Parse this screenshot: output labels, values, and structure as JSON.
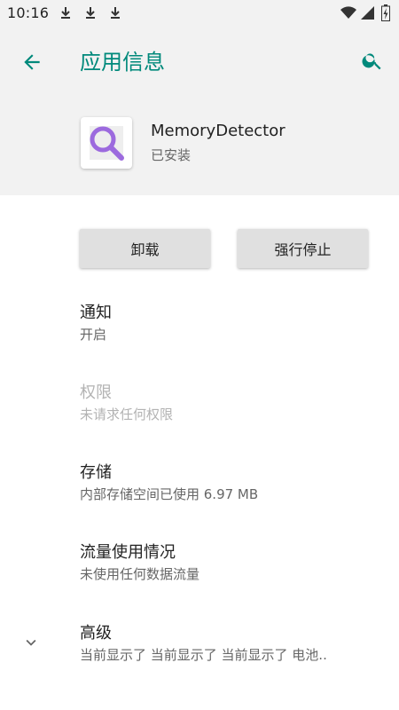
{
  "status_bar": {
    "time": "10:16",
    "icons": [
      "download-icon",
      "download-icon",
      "download-icon",
      "wifi-icon",
      "signal-icon",
      "battery-icon"
    ]
  },
  "header": {
    "title": "应用信息",
    "back_icon": "arrow-left-icon",
    "search_icon": "search-icon"
  },
  "app": {
    "name": "MemoryDetector",
    "status": "已安装",
    "icon": "magnifier-icon"
  },
  "actions": {
    "uninstall_label": "卸载",
    "force_stop_label": "强行停止"
  },
  "settings": [
    {
      "title": "通知",
      "subtitle": "开启"
    },
    {
      "title": "权限",
      "subtitle": "未请求任何权限"
    },
    {
      "title": "存储",
      "subtitle": "内部存储空间已使用 6.97 MB"
    },
    {
      "title": "流量使用情况",
      "subtitle": "未使用任何数据流量"
    },
    {
      "title": "高级",
      "subtitle": "当前显示了 当前显示了 当前显示了 电池.."
    }
  ],
  "colors": {
    "accent": "#00897b",
    "header_bg": "#f2f2f2",
    "icon_purple": "#9c6ade"
  }
}
